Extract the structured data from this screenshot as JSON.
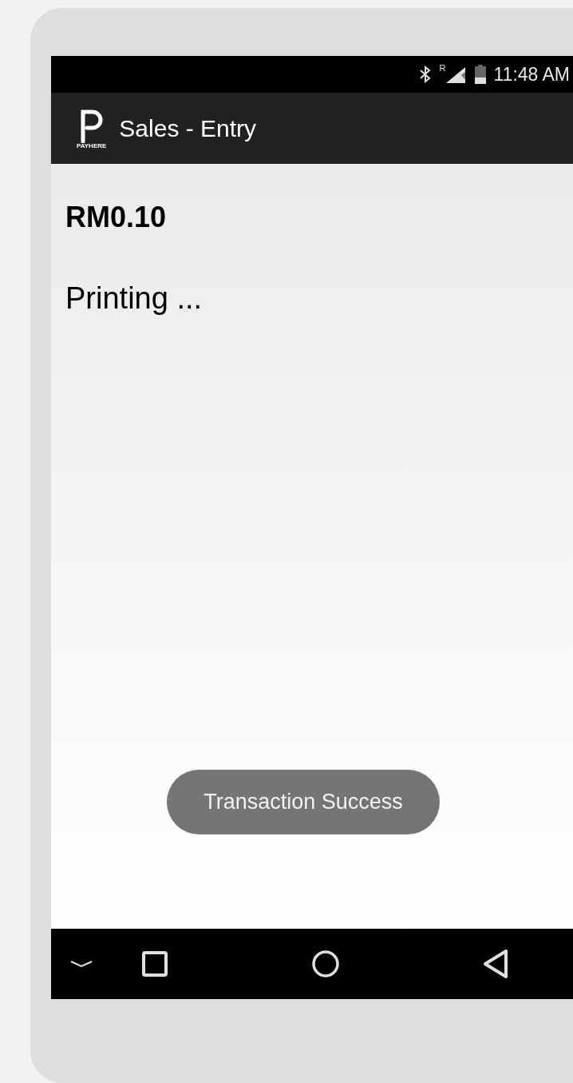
{
  "status_bar": {
    "time": "11:48 AM",
    "roaming_label": "R"
  },
  "app_bar": {
    "logo_text": "PAYHERE",
    "title": "Sales - Entry"
  },
  "content": {
    "amount": "RM0.10",
    "status": "Printing ..."
  },
  "toast": {
    "message": "Transaction Success"
  }
}
